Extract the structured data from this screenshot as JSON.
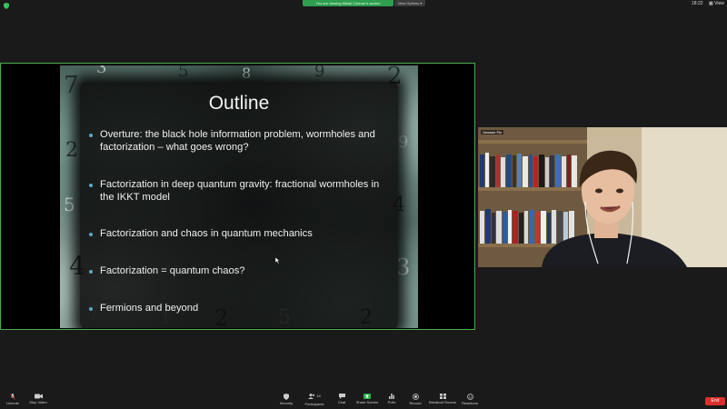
{
  "top_bar": {
    "share_banner": "You are viewing Mihail Cubnorr's screen",
    "view_options": "View Options",
    "clock": "18:22",
    "view_button": "View"
  },
  "slide": {
    "title": "Outline",
    "bullets": [
      "Overture: the black hole information problem, wormholes and factorization – what goes wrong?",
      "Factorization in deep quantum gravity: fractional wormholes in the IKKT model",
      "Factorization and chaos in quantum mechanics",
      "Factorization = quantum chaos?",
      "Fermions and beyond"
    ],
    "background_numbers": [
      "7",
      "3",
      "2",
      "5",
      "4",
      "7",
      "2",
      "9",
      "4",
      "3",
      "2",
      "1",
      "2",
      "5",
      "9",
      "8",
      "5"
    ]
  },
  "participant": {
    "name": "Vamsee Pin"
  },
  "toolbar": {
    "unmute": "Unmute",
    "stop_video": "Stop Video",
    "security": "Security",
    "participants": "Participants",
    "participants_count": "14",
    "chat": "Chat",
    "share_screen": "Share Screen",
    "polls": "Polls",
    "record": "Record",
    "breakout_rooms": "Breakout Rooms",
    "reactions": "Reactions",
    "end": "End"
  },
  "colors": {
    "screen_border": "#4cae4c",
    "share_banner": "#2e9e4f",
    "bullet": "#5aa9c9",
    "end_button": "#d9302c"
  }
}
